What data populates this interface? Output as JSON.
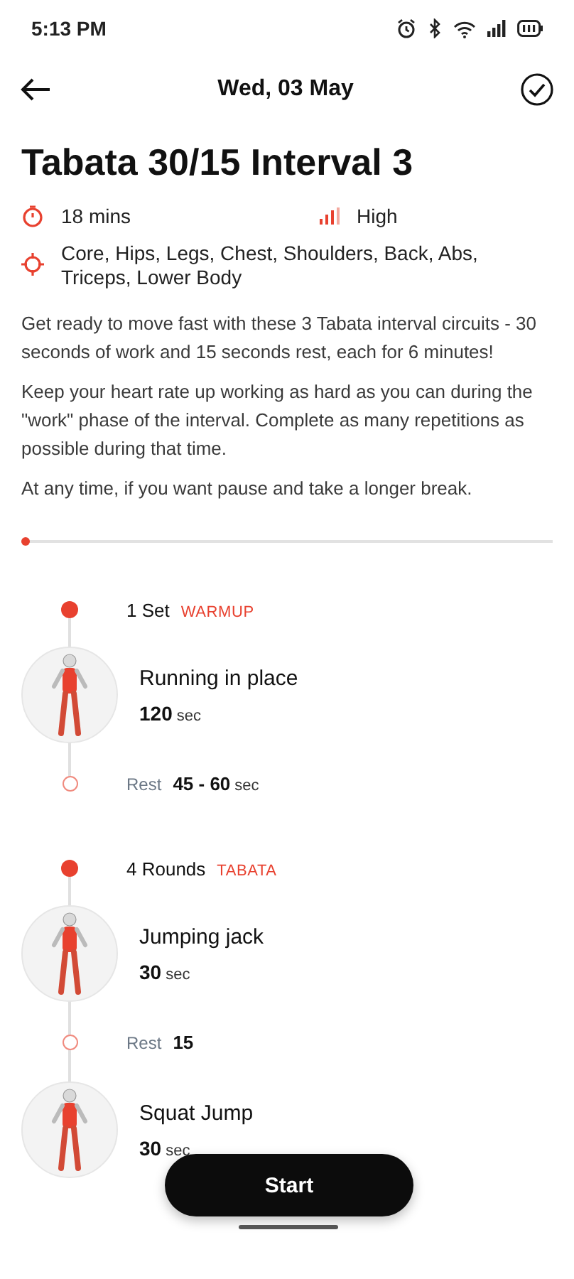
{
  "status_bar": {
    "time": "5:13 PM"
  },
  "header": {
    "title": "Wed, 03 May"
  },
  "workout": {
    "title": "Tabata 30/15 Interval 3",
    "duration": "18 mins",
    "intensity": "High",
    "muscles": "Core, Hips, Legs, Chest, Shoulders, Back, Abs, Triceps, Lower Body",
    "description": [
      "Get ready to move fast with these 3 Tabata interval circuits - 30 seconds of work and 15 seconds rest, each for 6 minutes!",
      "Keep your heart rate up working as hard as you can during the \"work\" phase of the interval. Complete as many repetitions as possible during that time.",
      "At any time, if you want pause and take a longer break."
    ]
  },
  "progress": {
    "level": 0
  },
  "timeline": [
    {
      "kind": "set",
      "count": "1 Set",
      "tag": "WARMUP"
    },
    {
      "kind": "exercise",
      "name": "Running in place",
      "value": "120",
      "unit": "sec"
    },
    {
      "kind": "rest",
      "label": "Rest",
      "value": "45 - 60",
      "unit": "sec"
    },
    {
      "kind": "set",
      "count": "4 Rounds",
      "tag": "TABATA"
    },
    {
      "kind": "exercise",
      "name": "Jumping jack",
      "value": "30",
      "unit": "sec"
    },
    {
      "kind": "rest",
      "label": "Rest",
      "value": "15"
    },
    {
      "kind": "exercise",
      "name": "Squat Jump",
      "value": "30",
      "unit": "sec"
    }
  ],
  "start_button": "Start"
}
